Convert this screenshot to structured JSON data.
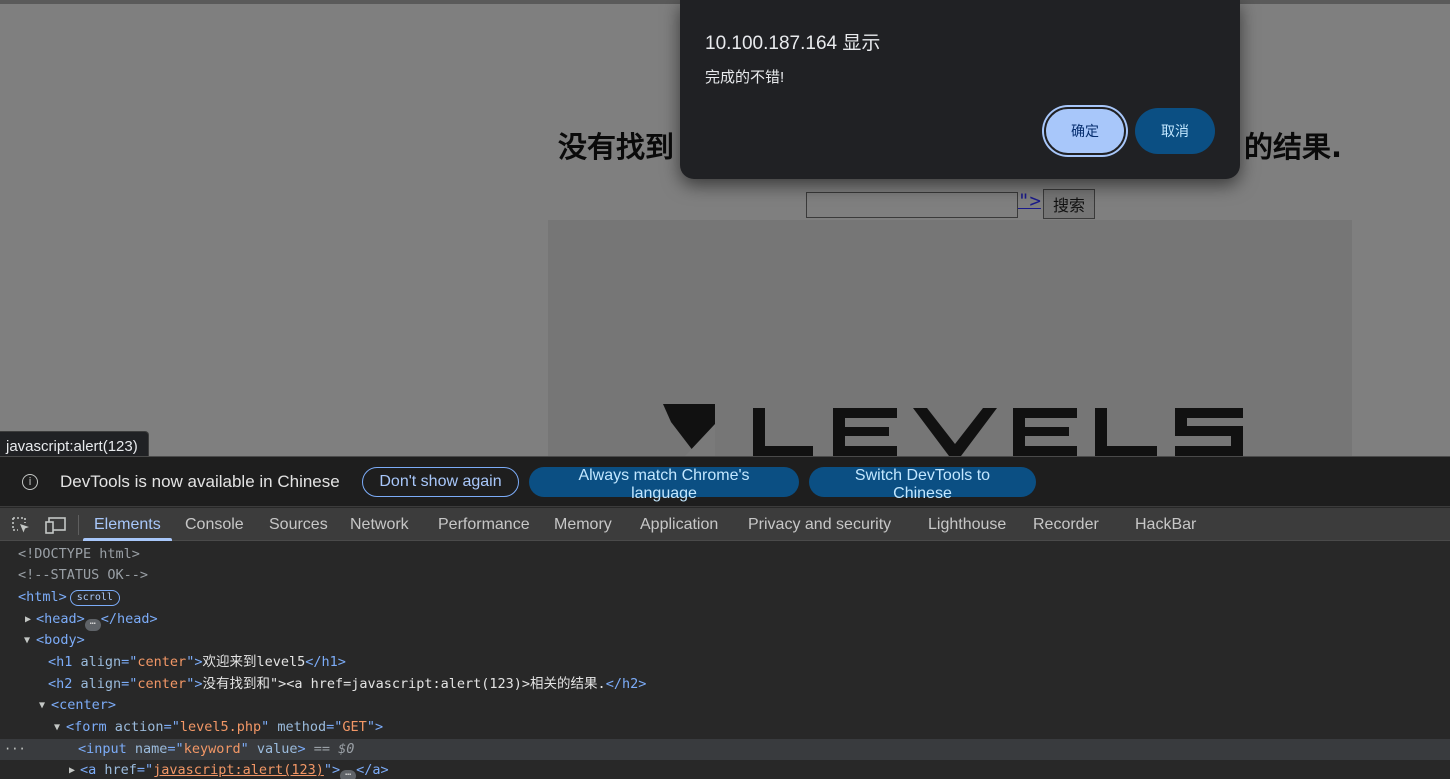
{
  "webpage": {
    "h2_left": "没有找到",
    "h2_right": "的结果.",
    "injected_link": "\">",
    "search_button": "搜索",
    "logo_text": "LEVEL5"
  },
  "status_tooltip": "javascript:alert(123)",
  "alert": {
    "title": "10.100.187.164 显示",
    "message": "完成的不错!",
    "ok_label": "确定",
    "cancel_label": "取消"
  },
  "devtools": {
    "infobar": {
      "icon": "info-icon",
      "text": "DevTools is now available in Chinese",
      "dont_show": "Don't show again",
      "always_match": "Always match Chrome's language",
      "switch": "Switch DevTools to Chinese"
    },
    "tabs": [
      "Elements",
      "Console",
      "Sources",
      "Network",
      "Performance",
      "Memory",
      "Application",
      "Privacy and security",
      "Lighthouse",
      "Recorder",
      "HackBar"
    ],
    "active_tab": "Elements",
    "dom": {
      "doctype": "<!DOCTYPE html>",
      "comment": "<!--STATUS OK-->",
      "html_open": "<html>",
      "scroll_badge": "scroll",
      "head_open": "<head>",
      "head_close": "</head>",
      "body_open": "<body>",
      "h1": {
        "open": "<h1 ",
        "attr": "align",
        "eq": "=\"",
        "val": "center",
        "close_q": "\">",
        "text": "欢迎来到level5",
        "end": "</h1>"
      },
      "h2": {
        "open": "<h2 ",
        "attr": "align",
        "eq": "=\"",
        "val": "center",
        "close_q": "\">",
        "text": "没有找到和\"><a href=javascript:alert(123)>相关的结果.",
        "end": "</h2>"
      },
      "center_open": "<center>",
      "form": {
        "open": "<form ",
        "attr1": "action",
        "val1": "level5.php",
        "attr2": "method",
        "val2": "GET",
        "end": "\">"
      },
      "input": {
        "open": "<input ",
        "attr1": "name",
        "val1": "keyword",
        "attr2": "value",
        "end": ">",
        "marker": "== $0"
      },
      "a": {
        "open": "<a ",
        "attr": "href",
        "val": "javascript:alert(123)",
        "end": "\">",
        "close": "</a>"
      }
    }
  }
}
